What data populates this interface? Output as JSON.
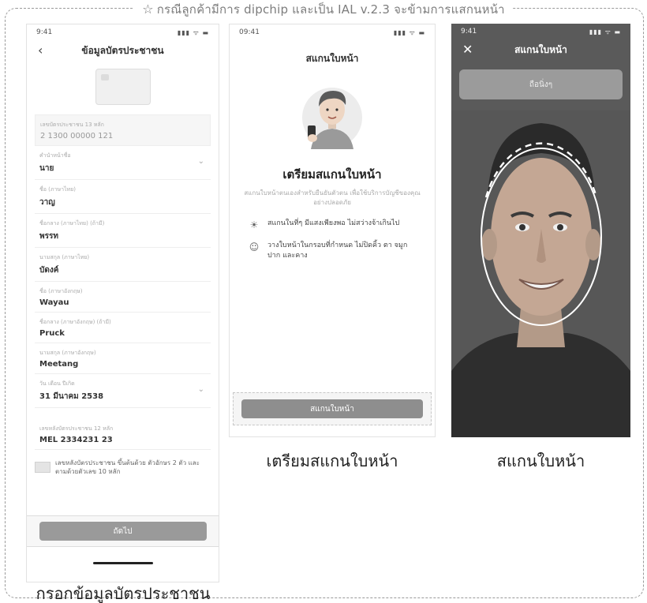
{
  "header": {
    "title": "กรณีลูกค้ามีการ dipchip และเป็น IAL v.2.3 จะข้ามการแสกนหน้า"
  },
  "screen1": {
    "time": "9:41",
    "status_icons": "▮▮▮ ᯤ ▬",
    "title": "ข้อมูลบัตรประชาชน",
    "fields": [
      {
        "label": "เลขบัตรประชาชน 13 หลัก",
        "value": "2 1300 00000 121"
      },
      {
        "label": "คำนำหน้าชื่อ",
        "value": "นาย"
      },
      {
        "label": "ชื่อ (ภาษาไทย)",
        "value": "วาญ"
      },
      {
        "label": "ชื่อกลาง (ภาษาไทย) (ถ้ามี)",
        "value": "พรรท"
      },
      {
        "label": "นามสกุล (ภาษาไทย)",
        "value": "บัดงค์"
      },
      {
        "label": "ชื่อ (ภาษาอังกฤษ)",
        "value": "Wayau"
      },
      {
        "label": "ชื่อกลาง (ภาษาอังกฤษ) (ถ้ามี)",
        "value": "Pruck"
      },
      {
        "label": "นามสกุล (ภาษาอังกฤษ)",
        "value": "Meetang"
      },
      {
        "label": "วัน เดือน ปีเกิด",
        "value": "31 มีนาคม 2538"
      },
      {
        "label": "เลขหลังบัตรประชาชน 12 หลัก",
        "value": "MEL 2334231 23"
      }
    ],
    "notice": "เลขหลังบัตรประชาชน ขึ้นต้นด้วย ตัวอักษร 2 ตัว และตามด้วยตัวเลข 10 หลัก",
    "button": "ถัดไป"
  },
  "screen2": {
    "time": "09:41",
    "status_icons": "▮▮▮ ᯤ ▬",
    "title": "สแกนใบหน้า",
    "heading": "เตรียมสแกนใบหน้า",
    "description": "สแกนใบหน้าตนเองสำหรับยืนยันตัวตน เพื่อใช้บริการบัญชีของคุณอย่างปลอดภัย",
    "tips": [
      {
        "icon": "lightbulb-icon",
        "text": "สแกนในที่ๆ มีแสงเพียงพอ ไม่สว่างจ้าเกินไป"
      },
      {
        "icon": "face-frame-icon",
        "text": "วางใบหน้าในกรอบที่กำหนด ไม่ปิดคิ้ว ตา จมูก ปาก และคาง"
      }
    ],
    "button": "สแกนใบหน้า"
  },
  "screen3": {
    "time": "9:41",
    "status_icons": "▮▮▮ ᯤ ▬",
    "title": "สแกนใบหน้า",
    "banner": "ถือนิ่งๆ"
  },
  "captions": {
    "screen1": "กรอกข้อมูลบัตรประชาชน",
    "screen2": "เตรียมสแกนใบหน้า",
    "screen3": "สแกนใบหน้า"
  }
}
